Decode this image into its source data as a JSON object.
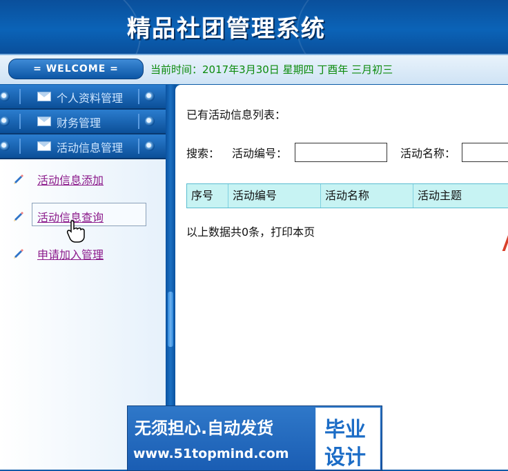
{
  "header": {
    "title": "精品社团管理系统"
  },
  "infobar": {
    "welcome": "= WELCOME =",
    "time_text": "当前时间：2017年3月30日 星期四 丁酉年 三月初三"
  },
  "sidebar": {
    "menus": [
      {
        "label": "个人资料管理"
      },
      {
        "label": "财务管理"
      },
      {
        "label": "活动信息管理"
      }
    ],
    "items": [
      {
        "label": "活动信息添加"
      },
      {
        "label": "活动信息查询"
      },
      {
        "label": "申请加入管理"
      }
    ]
  },
  "content": {
    "list_title": "已有活动信息列表：",
    "search_label": "搜索：",
    "field_a_label": "活动编号：",
    "field_b_label": "活动名称：",
    "table_headers": [
      "序号",
      "活动编号",
      "活动名称",
      "活动主题"
    ],
    "summary": "以上数据共0条，打印本页"
  },
  "banner": {
    "slogan": "无须担心.自动发货",
    "url": "www.51topmind.com",
    "badge_line1": "毕业",
    "badge_line2": "设计"
  },
  "colors": {
    "header_bg": "#0b63b7",
    "time_text": "#0b8a0b",
    "link": "#8b1a8b",
    "table_head_bg": "#c7f3f3"
  }
}
